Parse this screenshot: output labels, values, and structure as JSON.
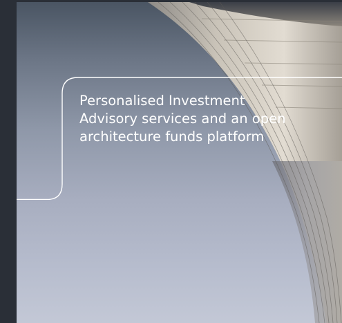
{
  "hero": {
    "headline_lines": [
      "Personalised Investment",
      "Advisory services and an open",
      "architecture funds platform"
    ]
  },
  "colors": {
    "page_background": "#2a2f37",
    "sky_top": "#4a5563",
    "sky_bottom": "#c3c8d6",
    "panel_light": "#dcd6cc",
    "panel_mid": "#b9b2a6",
    "frame_stroke": "#ffffff",
    "headline_text": "#ffffff"
  }
}
